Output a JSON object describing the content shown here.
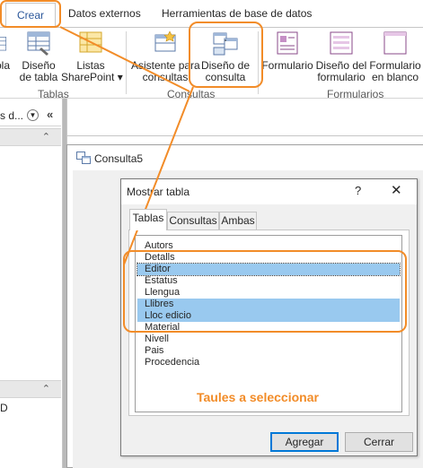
{
  "ribbon": {
    "tabs": [
      "Crear",
      "Datos externos",
      "Herramientas de base de datos"
    ],
    "buttons": {
      "tabla_cut": "bla",
      "diseno_tabla_1": "Diseño",
      "diseno_tabla_2": "de tabla",
      "listas_1": "Listas",
      "listas_2": "SharePoint ▾",
      "asistente_1": "Asistente para",
      "asistente_2": "consultas",
      "diseno_consulta_1": "Diseño de",
      "diseno_consulta_2": "consulta",
      "formulario": "Formulario",
      "diseno_formulario_1": "Diseño del",
      "diseno_formulario_2": "formulario",
      "formulario_blanco_1": "Formulario",
      "formulario_blanco_2": "en blanco"
    },
    "groups": [
      "Tablas",
      "Consultas",
      "Formularios"
    ]
  },
  "nav": {
    "title": "s d...",
    "collapse": "«",
    "section_chevron": "⌃",
    "bottom_label": "D"
  },
  "query_window": {
    "title": "Consulta5"
  },
  "dialog": {
    "title": "Mostrar tabla",
    "help": "?",
    "close": "✕",
    "tabs": [
      "Tablas",
      "Consultas",
      "Ambas"
    ],
    "items": [
      "Autors",
      "Detalls",
      "Editor",
      "Estatus",
      "Llengua",
      "Llibres",
      "Lloc edicio",
      "Material",
      "Nivell",
      "Pais",
      "Procedencia"
    ],
    "selected": [
      "Editor",
      "Llibres",
      "Lloc edicio"
    ],
    "add_button": "Agregar",
    "close_button": "Cerrar"
  },
  "annotation": {
    "hint": "Taules a seleccionar",
    "color": "#f28c28"
  },
  "colors": {
    "selection": "#99c9ef",
    "accent_blue": "#2b579a",
    "workspace_gray": "#b9b9b9"
  }
}
